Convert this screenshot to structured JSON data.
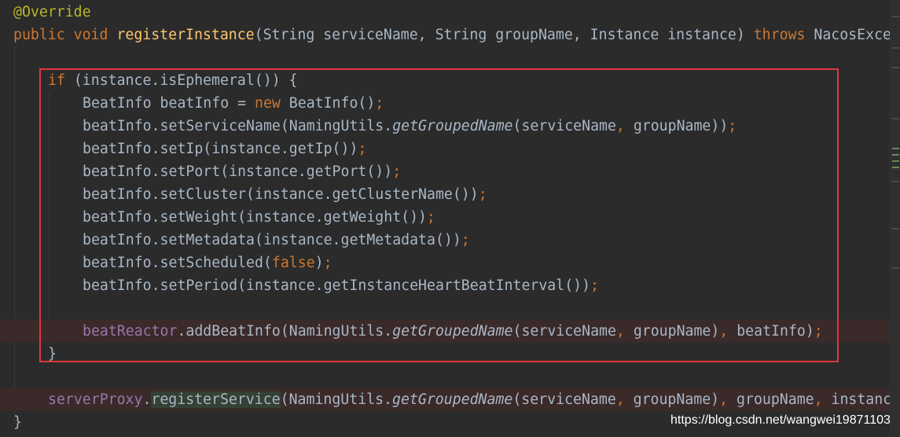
{
  "editor": {
    "line_annotation": "@Override",
    "sig_public": "public",
    "sig_void": "void",
    "sig_method": "registerInstance",
    "sig_params": "(String serviceName, String groupName, Instance instance) ",
    "sig_throws": "throws",
    "sig_exception": " NacosExce",
    "if_kw": "if",
    "if_cond": " (instance.isEphemeral()) {",
    "decl_type": "BeatInfo beatInfo = ",
    "decl_new": "new",
    "decl_ctor": " BeatInfo()",
    "decl_end": ";",
    "svcname_a": "beatInfo.setServiceName(NamingUtils.",
    "svcname_b": "getGroupedName",
    "svcname_c": "(serviceName",
    "svcname_d": ",",
    "svcname_e": " groupName))",
    "svcname_f": ";",
    "setip": "beatInfo.setIp(instance.getIp())",
    "setip_end": ";",
    "setport": "beatInfo.setPort(instance.getPort())",
    "setport_end": ";",
    "setcluster": "beatInfo.setCluster(instance.getClusterName())",
    "setcluster_end": ";",
    "setweight": "beatInfo.setWeight(instance.getWeight())",
    "setweight_end": ";",
    "setmeta": "beatInfo.setMetadata(instance.getMetadata())",
    "setmeta_end": ";",
    "setsched_a": "beatInfo.setScheduled(",
    "setsched_b": "false",
    "setsched_c": ")",
    "setsched_d": ";",
    "setperiod": "beatInfo.setPeriod(instance.getInstanceHeartBeatInterval())",
    "setperiod_end": ";",
    "reactor_field": "beatReactor",
    "reactor_a": ".addBeatInfo(NamingUtils.",
    "reactor_b": "getGroupedName",
    "reactor_c": "(serviceName",
    "reactor_d": ",",
    "reactor_e": " groupName)",
    "reactor_f": ",",
    "reactor_g": " beatInfo)",
    "reactor_h": ";",
    "close_brace": "}",
    "proxy_field": "serverProxy",
    "proxy_dot": ".",
    "proxy_method": "registerService",
    "proxy_a": "(NamingUtils.",
    "proxy_b": "getGroupedName",
    "proxy_c": "(serviceName",
    "proxy_d": ",",
    "proxy_e": " groupName)",
    "proxy_f": ",",
    "proxy_g": " groupName",
    "proxy_h": ",",
    "proxy_i": " instanc",
    "method_close": "}"
  },
  "watermark": "https://blog.csdn.net/wangwei19871103",
  "colors": {
    "background": "#2b2b2b",
    "keyword": "#cc7832",
    "annotation": "#bbb529",
    "method_decl": "#ffc66d",
    "field": "#9876aa",
    "text": "#a9b7c6",
    "highlight_box": "#e0383b"
  }
}
